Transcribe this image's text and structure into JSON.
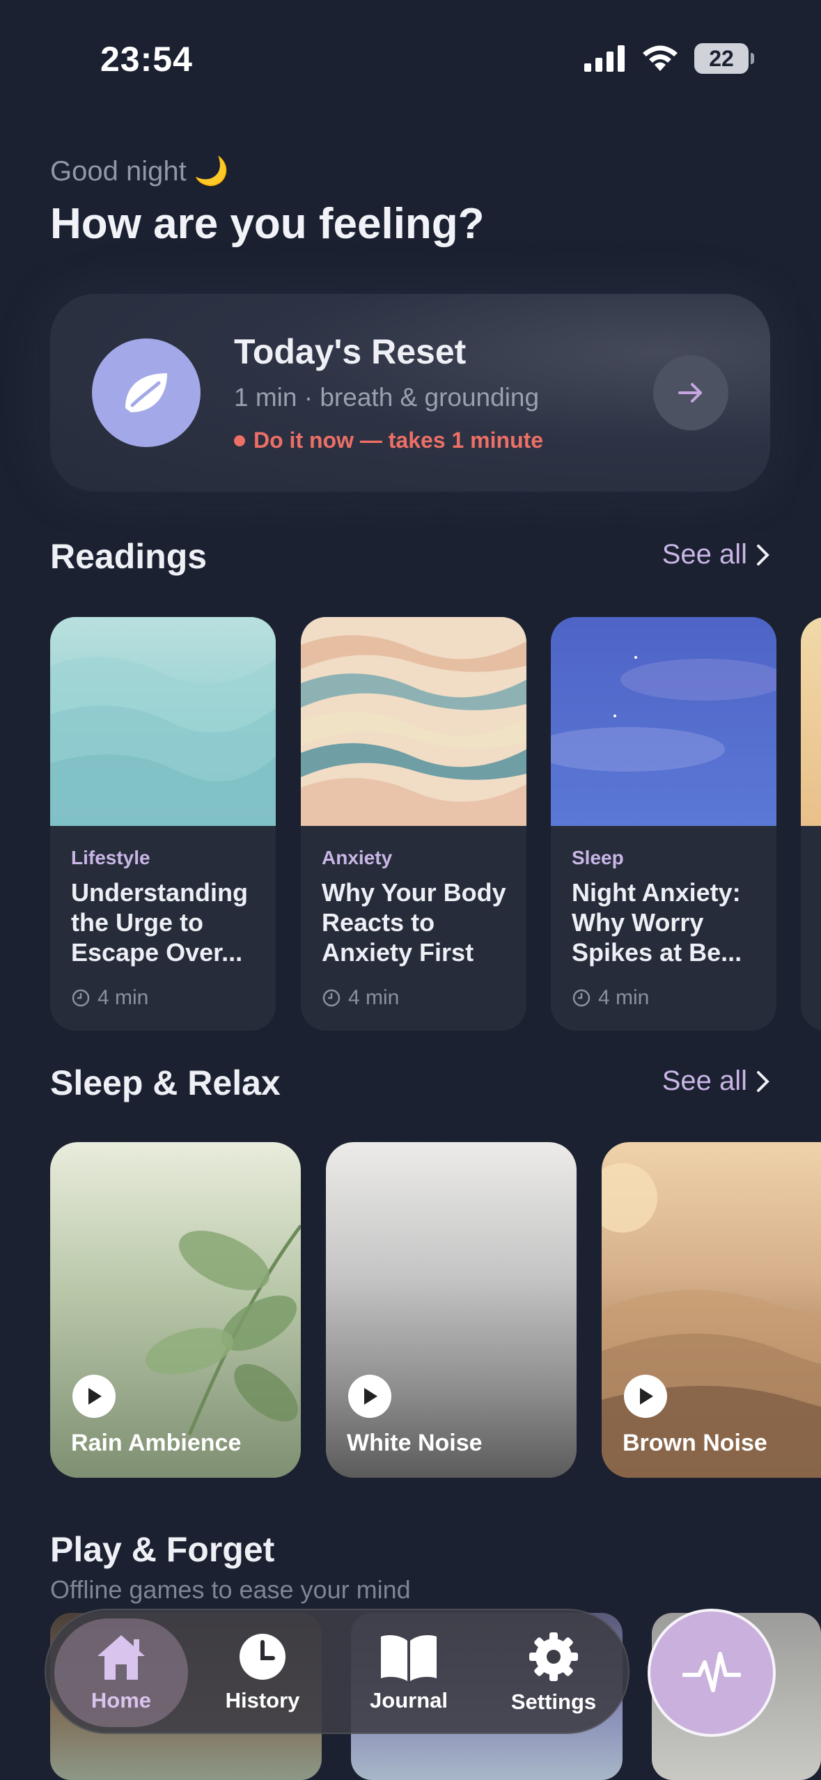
{
  "status_bar": {
    "time": "23:54",
    "battery": "22"
  },
  "greeting": {
    "subtitle": "Good night 🌙",
    "title": "How are you feeling?"
  },
  "reset_card": {
    "title": "Today's Reset",
    "subtitle": "1 min · breath & grounding",
    "cta": "Do it now — takes 1 minute",
    "icon": "leaf-icon"
  },
  "readings": {
    "title": "Readings",
    "see_all": "See all",
    "items": [
      {
        "category": "Lifestyle",
        "title": "Understanding the Urge to Escape Over...",
        "duration": "4 min"
      },
      {
        "category": "Anxiety",
        "title": "Why Your Body Reacts to Anxiety First",
        "duration": "4 min"
      },
      {
        "category": "Sleep",
        "title": "Night Anxiety: Why Worry Spikes at Be...",
        "duration": "4 min"
      }
    ]
  },
  "sleep": {
    "title": "Sleep & Relax",
    "see_all": "See all",
    "items": [
      {
        "label": "Rain Ambience"
      },
      {
        "label": "White Noise"
      },
      {
        "label": "Brown Noise"
      }
    ]
  },
  "play_forget": {
    "title": "Play & Forget",
    "subtitle": "Offline games to ease your mind"
  },
  "tabbar": {
    "tabs": [
      {
        "label": "Home",
        "icon": "home-icon",
        "active": true
      },
      {
        "label": "History",
        "icon": "clock-icon",
        "active": false
      },
      {
        "label": "Journal",
        "icon": "book-icon",
        "active": false
      },
      {
        "label": "Settings",
        "icon": "gear-icon",
        "active": false
      }
    ],
    "fab_icon": "pulse-icon"
  },
  "colors": {
    "background": "#1b2130",
    "accent": "#c9b6e6",
    "alert": "#ee6f66",
    "reset_icon_bg": "#a3a9e8"
  }
}
